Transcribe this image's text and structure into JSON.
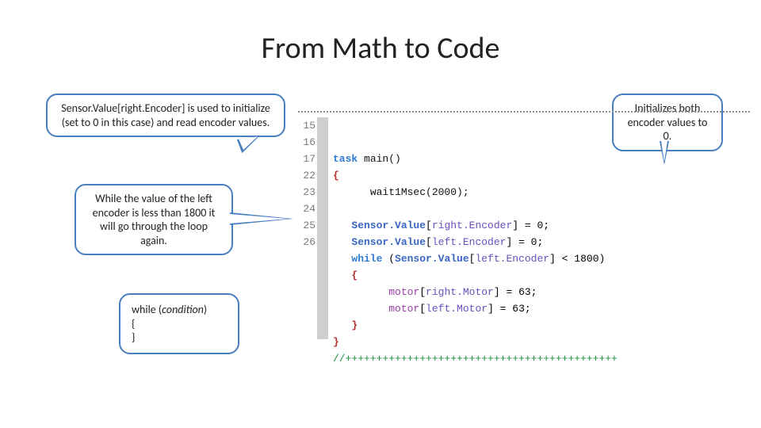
{
  "title": "From Math to Code",
  "callouts": {
    "c1": "Sensor.Value[right.Encoder] is used to initialize (set to 0 in this case) and read encoder values.",
    "c2": "While the value of the left encoder is less than 1800 it will go through the loop again.",
    "c3_line1": "while (",
    "c3_cond": "condition",
    "c3_line1_end": ")",
    "c3_line2": "{",
    "c3_line3": "}",
    "c4": "Initializes both encoder values to 0."
  },
  "gutter": [
    "",
    "",
    "",
    "15",
    "16",
    "17",
    "",
    "",
    "",
    "",
    "",
    "22",
    "23",
    "24",
    "25",
    "26"
  ],
  "code": {
    "l1": {
      "pre": "",
      "content": ""
    },
    "l2": {
      "task": "task",
      "main": " main",
      "paren": "()"
    },
    "l3": "{",
    "l4_indent": "      ",
    "l4_fn": "wait1Msec",
    "l4_arg": "(2000);",
    "blank": "",
    "l6_indent": "   ",
    "l6_sv": "Sensor.Value",
    "l6_br": "[",
    "l6_enc": "right.Encoder",
    "l6_rest": "] = 0;",
    "l7_indent": "   ",
    "l7_sv": "Sensor.Value",
    "l7_br": "[",
    "l7_enc": "left.Encoder",
    "l7_rest": "] = 0;",
    "l8_indent": "   ",
    "l8_while": "while",
    "l8_open": " (",
    "l8_sv": "Sensor.Value",
    "l8_br": "[",
    "l8_enc": "left.Encoder",
    "l8_close": "] < 1800)",
    "l9_indent": "   ",
    "l9": "{",
    "l10_indent": "         ",
    "l10_m": "motor",
    "l10_br": "[",
    "l10_mn": "right.Motor",
    "l10_rest": "] = 63;",
    "l11_indent": "         ",
    "l11_m": "motor",
    "l11_br": "[",
    "l11_mn": "left.Motor",
    "l11_rest": "] = 63;",
    "l12_indent": "   ",
    "l12": "}",
    "l13": "}",
    "l14": "//++++++++++++++++++++++++++++++++++++++++++++"
  }
}
